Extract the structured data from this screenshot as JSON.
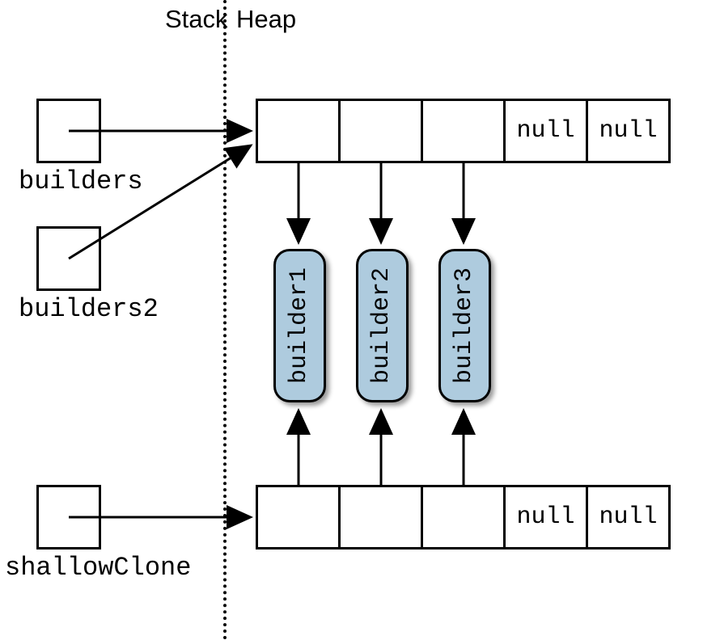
{
  "headers": {
    "stack": "Stack",
    "heap": "Heap"
  },
  "stackVars": {
    "builders": "builders",
    "builders2": "builders2",
    "shallowClone": "shallowClone"
  },
  "builderObjects": {
    "b1": "builder1",
    "b2": "builder2",
    "b3": "builder3"
  },
  "arrayTop": {
    "c4": "null",
    "c5": "null"
  },
  "arrayBottom": {
    "c4": "null",
    "c5": "null"
  }
}
